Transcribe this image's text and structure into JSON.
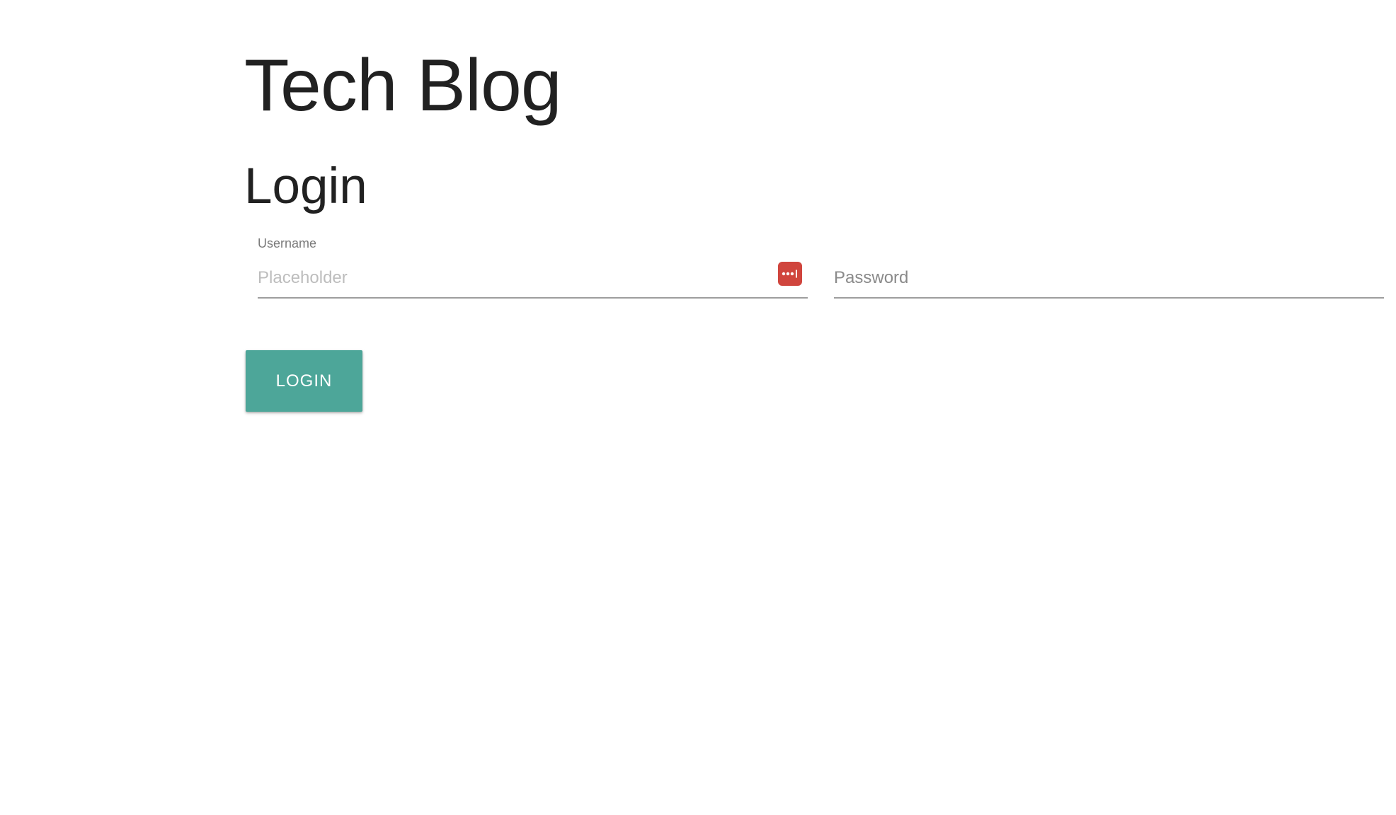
{
  "header": {
    "site_title": "Tech Blog"
  },
  "main": {
    "page_title": "Login",
    "username": {
      "label": "Username",
      "placeholder": "Placeholder",
      "value": ""
    },
    "password": {
      "placeholder": "Password",
      "value": ""
    },
    "login_button_label": "LOGIN"
  },
  "icons": {
    "password_manager": "password-manager-icon"
  },
  "colors": {
    "button": "#4da699",
    "password_manager_icon": "#d0453d",
    "text": "#212121"
  }
}
